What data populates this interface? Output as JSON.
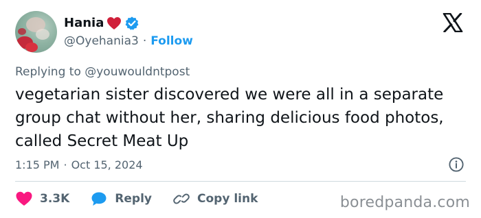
{
  "author": {
    "display_name": "Hania",
    "handle": "@Oyehania3",
    "separator": "·",
    "follow_label": "Follow"
  },
  "reply_context": {
    "prefix": "Replying to ",
    "mention": "@youwouldntpost"
  },
  "tweet": {
    "text": "vegetarian sister discovered we were all in a separate group chat without her, sharing delicious food photos, called Secret Meat Up"
  },
  "meta": {
    "time": "1:15 PM",
    "separator": "·",
    "date": "Oct 15, 2024"
  },
  "actions": {
    "likes_count": "3.3K",
    "reply_label": "Reply",
    "copy_link_label": "Copy link"
  },
  "watermark": "boredpanda.com",
  "icons": {
    "heart_emoji": "red-heart-emoji",
    "verified": "verified-badge-icon",
    "platform": "x-logo-icon",
    "info": "info-icon",
    "like": "heart-icon",
    "reply": "speech-bubble-icon",
    "copy_link": "link-icon"
  },
  "colors": {
    "text_primary": "#0f1419",
    "text_secondary": "#536471",
    "follow_blue": "#1d9bf0",
    "like_pink": "#f91880",
    "reply_blue": "#1d9bf0",
    "divider": "#cfd9de"
  }
}
